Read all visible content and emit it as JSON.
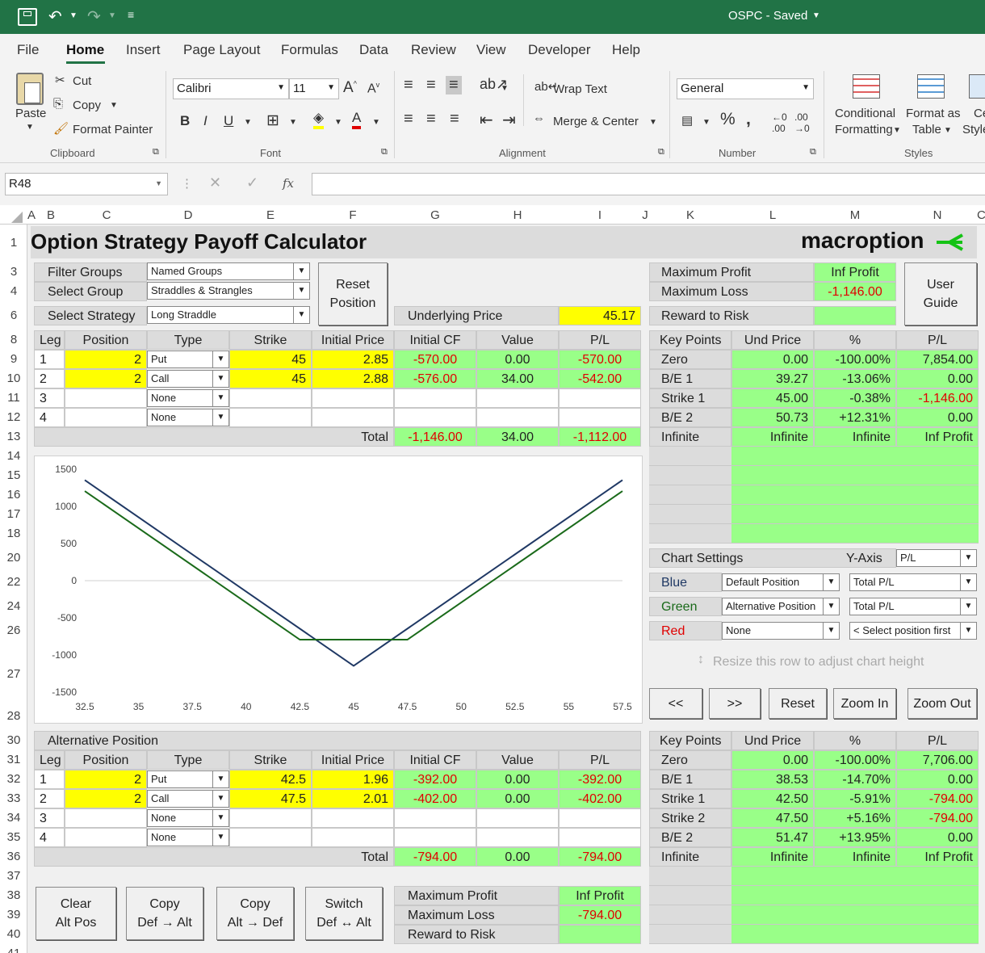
{
  "app": {
    "title": "OSPC - Saved"
  },
  "ribbon_tabs": [
    "File",
    "Home",
    "Insert",
    "Page Layout",
    "Formulas",
    "Data",
    "Review",
    "View",
    "Developer",
    "Help"
  ],
  "ribbon": {
    "paste": "Paste",
    "cut": "Cut",
    "copy": "Copy",
    "format_painter": "Format Painter",
    "clipboard": "Clipboard",
    "font_name": "Calibri",
    "font_size": "11",
    "font": "Font",
    "wrap_text": "Wrap Text",
    "merge_center": "Merge & Center",
    "alignment": "Alignment",
    "number_format": "General",
    "number": "Number",
    "cond_fmt_1": "Conditional",
    "cond_fmt_2": "Formatting",
    "format_as_1": "Format as",
    "format_as_2": "Table",
    "cell_styles_1": "Ce",
    "cell_styles_2": "Style",
    "styles": "Styles"
  },
  "formula_bar": {
    "name_box": "R48",
    "fx": "fx"
  },
  "columns": [
    "A",
    "B",
    "C",
    "D",
    "E",
    "F",
    "G",
    "H",
    "I",
    "J",
    "K",
    "L",
    "M",
    "N",
    "C"
  ],
  "rows": [
    "1",
    "3",
    "4",
    "6",
    "8",
    "9",
    "10",
    "11",
    "12",
    "13",
    "14",
    "15",
    "16",
    "17",
    "18",
    "20",
    "22",
    "24",
    "26",
    "27",
    "28",
    "30",
    "31",
    "32",
    "33",
    "34",
    "35",
    "36",
    "37",
    "38",
    "39",
    "40",
    "41"
  ],
  "title": "Option Strategy Payoff Calculator",
  "logo": "macroption",
  "filter": {
    "filter_label": "Filter Groups",
    "filter_value": "Named Groups",
    "group_label": "Select Group",
    "group_value": "Straddles & Strangles",
    "strategy_label": "Select Strategy",
    "strategy_value": "Long Straddle",
    "reset_btn_1": "Reset",
    "reset_btn_2": "Position",
    "und_label": "Underlying Price",
    "und_value": "45.17"
  },
  "summary": {
    "max_profit_label": "Maximum Profit",
    "max_profit": "Inf Profit",
    "max_loss_label": "Maximum Loss",
    "max_loss": "-1,146.00",
    "rr_label": "Reward to Risk",
    "guide_1": "User",
    "guide_2": "Guide"
  },
  "legs_headers": [
    "Leg",
    "Position",
    "Type",
    "Strike",
    "Initial Price",
    "Initial CF",
    "Value",
    "P/L"
  ],
  "legs": [
    {
      "leg": "1",
      "pos": "2",
      "type": "Put",
      "strike": "45",
      "price": "2.85",
      "cf": "-570.00",
      "value": "0.00",
      "pl": "-570.00"
    },
    {
      "leg": "2",
      "pos": "2",
      "type": "Call",
      "strike": "45",
      "price": "2.88",
      "cf": "-576.00",
      "value": "34.00",
      "pl": "-542.00"
    },
    {
      "leg": "3",
      "pos": "",
      "type": "None",
      "strike": "",
      "price": "",
      "cf": "",
      "value": "",
      "pl": ""
    },
    {
      "leg": "4",
      "pos": "",
      "type": "None",
      "strike": "",
      "price": "",
      "cf": "",
      "value": "",
      "pl": ""
    }
  ],
  "total": {
    "label": "Total",
    "cf": "-1,146.00",
    "value": "34.00",
    "pl": "-1,112.00"
  },
  "kp_headers": [
    "Key Points",
    "Und Price",
    "%",
    "P/L"
  ],
  "kp": [
    {
      "name": "Zero",
      "und": "0.00",
      "pct": "-100.00%",
      "pl": "7,854.00"
    },
    {
      "name": "B/E 1",
      "und": "39.27",
      "pct": "-13.06%",
      "pl": "0.00"
    },
    {
      "name": "Strike 1",
      "und": "45.00",
      "pct": "-0.38%",
      "pl": "-1,146.00"
    },
    {
      "name": "B/E 2",
      "und": "50.73",
      "pct": "+12.31%",
      "pl": "0.00"
    },
    {
      "name": "Infinite",
      "und": "Infinite",
      "pct": "Infinite",
      "pl": "Inf Profit"
    }
  ],
  "chart_settings": {
    "label": "Chart Settings",
    "yaxis_label": "Y-Axis",
    "yaxis": "P/L",
    "blue": "Blue",
    "blue_pos": "Default Position",
    "blue_val": "Total P/L",
    "green": "Green",
    "green_pos": "Alternative Position",
    "green_val": "Total P/L",
    "red": "Red",
    "red_pos": "None",
    "red_val": "< Select position first",
    "resize_hint": "Resize this row to adjust chart height"
  },
  "nav": [
    "<<",
    ">>",
    "Reset",
    "Zoom In",
    "Zoom Out"
  ],
  "alt": {
    "title": "Alternative Position",
    "legs": [
      {
        "leg": "1",
        "pos": "2",
        "type": "Put",
        "strike": "42.5",
        "price": "1.96",
        "cf": "-392.00",
        "value": "0.00",
        "pl": "-392.00"
      },
      {
        "leg": "2",
        "pos": "2",
        "type": "Call",
        "strike": "47.5",
        "price": "2.01",
        "cf": "-402.00",
        "value": "0.00",
        "pl": "-402.00"
      },
      {
        "leg": "3",
        "pos": "",
        "type": "None",
        "strike": "",
        "price": "",
        "cf": "",
        "value": "",
        "pl": ""
      },
      {
        "leg": "4",
        "pos": "",
        "type": "None",
        "strike": "",
        "price": "",
        "cf": "",
        "value": "",
        "pl": ""
      }
    ],
    "total": {
      "label": "Total",
      "cf": "-794.00",
      "value": "0.00",
      "pl": "-794.00"
    },
    "kp": [
      {
        "name": "Zero",
        "und": "0.00",
        "pct": "-100.00%",
        "pl": "7,706.00"
      },
      {
        "name": "B/E 1",
        "und": "38.53",
        "pct": "-14.70%",
        "pl": "0.00"
      },
      {
        "name": "Strike 1",
        "und": "42.50",
        "pct": "-5.91%",
        "pl": "-794.00"
      },
      {
        "name": "Strike 2",
        "und": "47.50",
        "pct": "+5.16%",
        "pl": "-794.00"
      },
      {
        "name": "B/E 2",
        "und": "51.47",
        "pct": "+13.95%",
        "pl": "0.00"
      },
      {
        "name": "Infinite",
        "und": "Infinite",
        "pct": "Infinite",
        "pl": "Inf Profit"
      }
    ],
    "max_profit_label": "Maximum Profit",
    "max_profit": "Inf Profit",
    "max_loss_label": "Maximum Loss",
    "max_loss": "-794.00",
    "rr_label": "Reward to Risk"
  },
  "alt_buttons": [
    {
      "l1": "Clear",
      "l2": "Alt Pos"
    },
    {
      "l1": "Copy",
      "l2": "Def → Alt"
    },
    {
      "l1": "Copy",
      "l2": "Alt → Def"
    },
    {
      "l1": "Switch",
      "l2": "Def ↔ Alt"
    }
  ],
  "chart_data": {
    "type": "line",
    "xlim": [
      32.5,
      57.5
    ],
    "ylim": [
      -1500,
      1500
    ],
    "x_ticks": [
      "32.5",
      "35",
      "37.5",
      "40",
      "42.5",
      "45",
      "47.5",
      "50",
      "52.5",
      "55",
      "57.5"
    ],
    "y_ticks": [
      "1500",
      "1000",
      "500",
      "0",
      "-500",
      "-1000",
      "-1500"
    ],
    "series": [
      {
        "color": "#1f3864",
        "x": [
          32.5,
          45,
          57.5
        ],
        "y": [
          1354,
          -1146,
          1354
        ]
      },
      {
        "color": "#1a6a1a",
        "x": [
          32.5,
          42.5,
          47.5,
          57.5
        ],
        "y": [
          1206,
          -794,
          -794,
          1206
        ]
      }
    ]
  }
}
